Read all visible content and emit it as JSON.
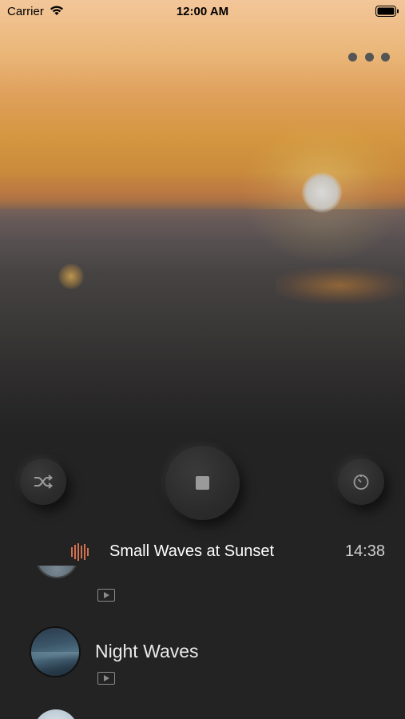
{
  "status_bar": {
    "carrier": "Carrier",
    "time": "12:00 AM"
  },
  "hero": {
    "more_icon": "more-horizontal-icon"
  },
  "controls": {
    "shuffle_icon": "shuffle-icon",
    "stop_icon": "stop-icon",
    "timer_icon": "timer-icon"
  },
  "now_playing": {
    "title": "Small Waves at Sunset",
    "time": "14:38",
    "icon": "equalizer-icon",
    "accent": "#d2704f"
  },
  "list": {
    "items": [
      {
        "title": "",
        "badge_icon": "play-video-icon"
      },
      {
        "title": "Night Waves",
        "badge_icon": "play-video-icon"
      },
      {
        "title": ""
      }
    ]
  }
}
